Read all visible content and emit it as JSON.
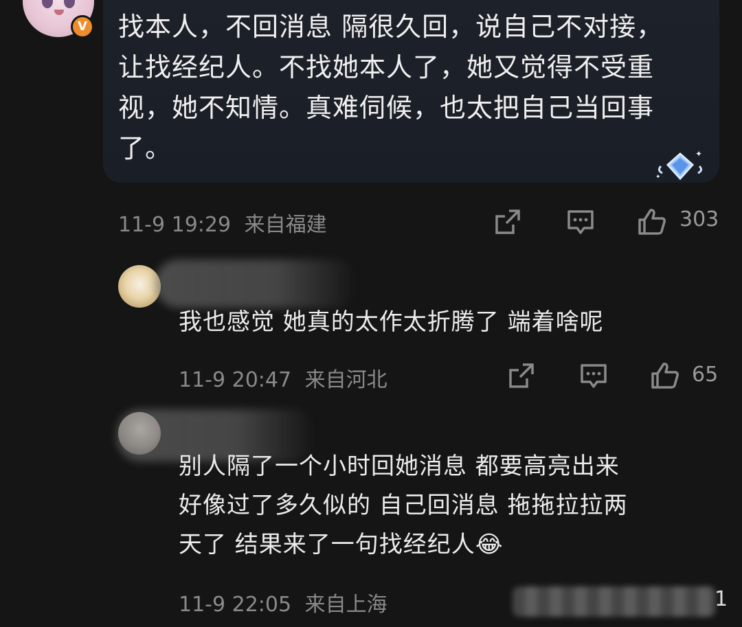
{
  "main_comment": {
    "text_lines": [
      "找本人，不回消息 隔很久回，说自己不对接，",
      "让找经纪人。不找她本人了，她又觉得不受重",
      "视，她不知情。真难伺候，也太把自己当回事",
      "了。"
    ],
    "time": "11-9 19:29",
    "location": "来自福建",
    "likes": "303",
    "badge": "V"
  },
  "replies": [
    {
      "text_lines": [
        "我也感觉 她真的太作太折腾了 端着啥呢"
      ],
      "time": "11-9 20:47",
      "location": "来自河北",
      "likes": "65"
    },
    {
      "text_lines": [
        "别人隔了一个小时回她消息 都要高亮出来",
        "好像过了多久似的 自己回消息 拖拖拉拉两",
        "天了 结果来了一句找经纪人"
      ],
      "emoji": "😂",
      "time": "11-9 22:05",
      "location": "来自上海",
      "likes": "1"
    }
  ],
  "colors": {
    "background": "#151515",
    "bubble": "#1d2129",
    "meta_text": "#8a8a8a",
    "badge": "#ef8c2b"
  },
  "icons": [
    "share-icon",
    "comment-icon",
    "like-icon",
    "diamond-badge-icon"
  ]
}
